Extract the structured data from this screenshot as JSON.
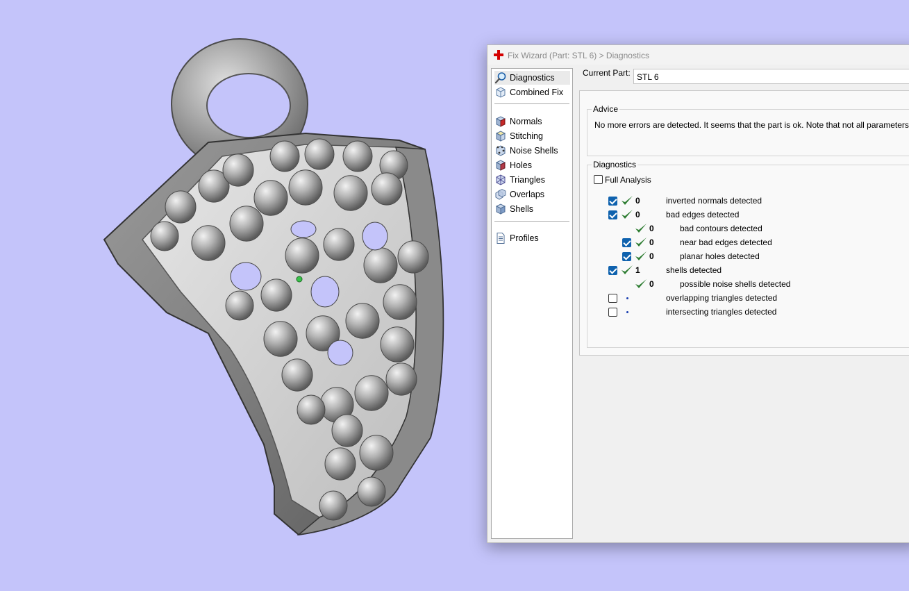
{
  "window": {
    "title": "Fix Wizard (Part: STL 6) > Diagnostics",
    "accent_color": "#d40000"
  },
  "nav": {
    "items": [
      {
        "label": "Diagnostics",
        "icon": "magnifier-icon",
        "selected": true
      },
      {
        "label": "Combined Fix",
        "icon": "combined-fix-cube-icon"
      },
      {
        "label": "Normals",
        "icon": "normals-cube-icon"
      },
      {
        "label": "Stitching",
        "icon": "stitching-cube-icon"
      },
      {
        "label": "Noise Shells",
        "icon": "noise-shells-cube-icon"
      },
      {
        "label": "Holes",
        "icon": "holes-cube-icon"
      },
      {
        "label": "Triangles",
        "icon": "triangles-cube-icon"
      },
      {
        "label": "Overlaps",
        "icon": "overlaps-cube-icon"
      },
      {
        "label": "Shells",
        "icon": "shells-cube-icon"
      },
      {
        "label": "Profiles",
        "icon": "document-icon"
      }
    ]
  },
  "current_part": {
    "label": "Current Part:",
    "value": "STL 6"
  },
  "advice": {
    "title": "Advice",
    "text": "No more errors are detected. It seems that the part is ok. Note that not all parameters were a"
  },
  "diagnostics": {
    "title": "Diagnostics",
    "full_analysis_label": "Full Analysis",
    "full_analysis_checked": false,
    "check_color": "#2e7d32",
    "checkbox_color": "#0f62ae",
    "rows": [
      {
        "checked": true,
        "status": "ok",
        "count": "0",
        "label": "inverted normals detected",
        "level": 0,
        "has_checkbox": true
      },
      {
        "checked": true,
        "status": "ok",
        "count": "0",
        "label": "bad edges detected",
        "level": 0,
        "has_checkbox": true
      },
      {
        "checked": false,
        "status": "ok",
        "count": "0",
        "label": "bad contours detected",
        "level": 1,
        "has_checkbox": false
      },
      {
        "checked": true,
        "status": "ok",
        "count": "0",
        "label": "near bad edges detected",
        "level": 1,
        "has_checkbox": true
      },
      {
        "checked": true,
        "status": "ok",
        "count": "0",
        "label": "planar holes detected",
        "level": 1,
        "has_checkbox": true
      },
      {
        "checked": true,
        "status": "ok",
        "count": "1",
        "label": "shells detected",
        "level": 0,
        "has_checkbox": true
      },
      {
        "checked": false,
        "status": "ok",
        "count": "0",
        "label": "possible noise shells detected",
        "level": 1,
        "has_checkbox": false
      },
      {
        "checked": false,
        "status": "pending",
        "count": "",
        "label": "overlapping triangles detected",
        "level": 0,
        "has_checkbox": true
      },
      {
        "checked": false,
        "status": "pending",
        "count": "",
        "label": "intersecting triangles detected",
        "level": 0,
        "has_checkbox": true
      }
    ]
  }
}
